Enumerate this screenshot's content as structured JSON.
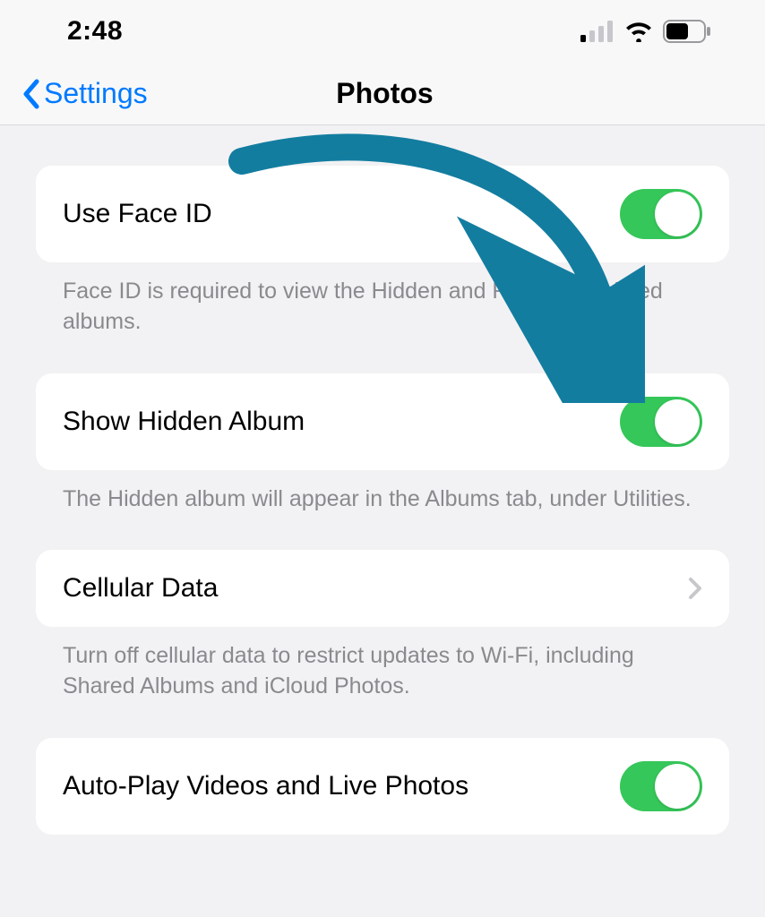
{
  "status": {
    "time": "2:48"
  },
  "nav": {
    "back_label": "Settings",
    "title": "Photos"
  },
  "settings": [
    {
      "label": "Use Face ID",
      "type": "toggle",
      "on": true,
      "desc": "Face ID is required to view the Hidden and Recently Deleted albums."
    },
    {
      "label": "Show Hidden Album",
      "type": "toggle",
      "on": true,
      "desc": "The Hidden album will appear in the Albums tab, under Utilities."
    },
    {
      "label": "Cellular Data",
      "type": "drill",
      "desc": "Turn off cellular data to restrict updates to Wi-Fi, including Shared Albums and iCloud Photos."
    },
    {
      "label": "Auto-Play Videos and Live Photos",
      "type": "toggle",
      "on": true,
      "desc": ""
    }
  ],
  "colors": {
    "toggle_on": "#35c759",
    "link": "#007aff",
    "arrow": "#137da0"
  }
}
